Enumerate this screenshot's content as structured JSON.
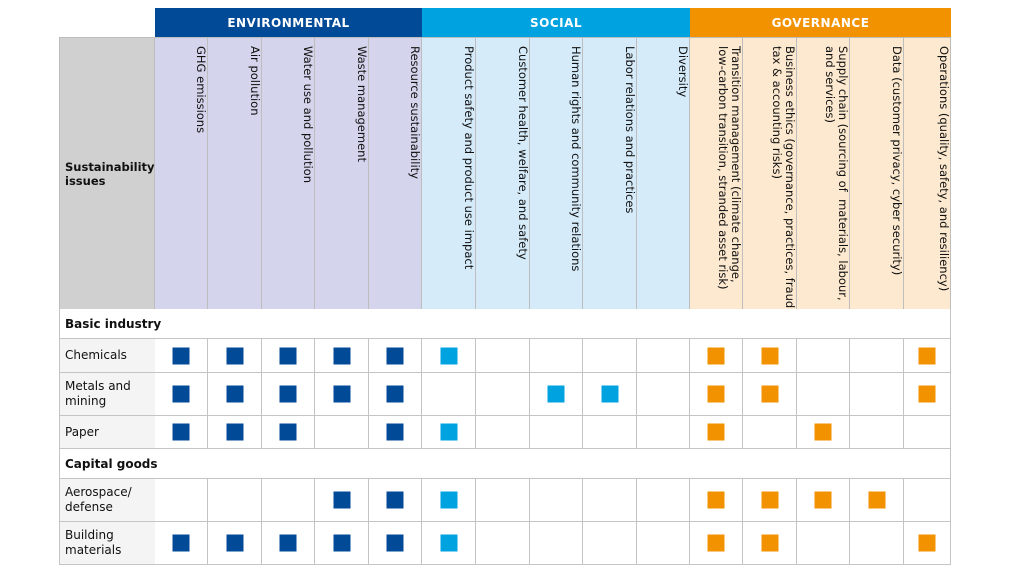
{
  "colors": {
    "environmental": "#004a98",
    "social": "#00a3e0",
    "governance": "#f39200",
    "environmental_bg": "#d4d5ec",
    "social_bg": "#d5ebfa",
    "governance_bg": "#fde9cf"
  },
  "groups": [
    {
      "key": "environmental",
      "label": "ENVIRONMENTAL"
    },
    {
      "key": "social",
      "label": "SOCIAL"
    },
    {
      "key": "governance",
      "label": "GOVERNANCE"
    }
  ],
  "header_label": "Sustainability\nissues",
  "columns": [
    {
      "group": "environmental",
      "label": "GHG emissions"
    },
    {
      "group": "environmental",
      "label": "Air pollution"
    },
    {
      "group": "environmental",
      "label": "Water use and pollution"
    },
    {
      "group": "environmental",
      "label": "Waste management"
    },
    {
      "group": "environmental",
      "label": "Resource sustainability"
    },
    {
      "group": "social",
      "label": "Product safety and product use impact"
    },
    {
      "group": "social",
      "label": "Customer health, welfare, and safety"
    },
    {
      "group": "social",
      "label": "Human rights and community relations"
    },
    {
      "group": "social",
      "label": "Labor relations and practices"
    },
    {
      "group": "social",
      "label": "Diversity"
    },
    {
      "group": "governance",
      "label": "Transition management (climate change,\nlow-carbon transition, stranded asset risk)"
    },
    {
      "group": "governance",
      "label": "Business ethics (governance, practices, fraud,\ntax & accounting risks)"
    },
    {
      "group": "governance",
      "label": "Supply chain (sourcing of  materials, labour,\nand services)"
    },
    {
      "group": "governance",
      "label": "Data (customer privacy, cyber security)"
    },
    {
      "group": "governance",
      "label": "Operations (quality, safety, and resiliency)"
    }
  ],
  "rows": [
    {
      "type": "section",
      "label": "Basic industry"
    },
    {
      "type": "industry",
      "label": "Chemicals",
      "marks": [
        1,
        1,
        1,
        1,
        1,
        1,
        0,
        0,
        0,
        0,
        1,
        1,
        0,
        0,
        1
      ]
    },
    {
      "type": "industry",
      "label": "Metals and\nmining",
      "marks": [
        1,
        1,
        1,
        1,
        1,
        0,
        0,
        1,
        1,
        0,
        1,
        1,
        0,
        0,
        1
      ]
    },
    {
      "type": "industry",
      "label": "Paper",
      "marks": [
        1,
        1,
        1,
        0,
        1,
        1,
        0,
        0,
        0,
        0,
        1,
        0,
        1,
        0,
        0
      ]
    },
    {
      "type": "section",
      "label": "Capital goods"
    },
    {
      "type": "industry",
      "label": "Aerospace/\ndefense",
      "marks": [
        0,
        0,
        0,
        1,
        1,
        1,
        0,
        0,
        0,
        0,
        1,
        1,
        1,
        1,
        0
      ]
    },
    {
      "type": "industry",
      "label": "Building\nmaterials",
      "marks": [
        1,
        1,
        1,
        1,
        1,
        1,
        0,
        0,
        0,
        0,
        1,
        1,
        0,
        0,
        1
      ]
    }
  ]
}
